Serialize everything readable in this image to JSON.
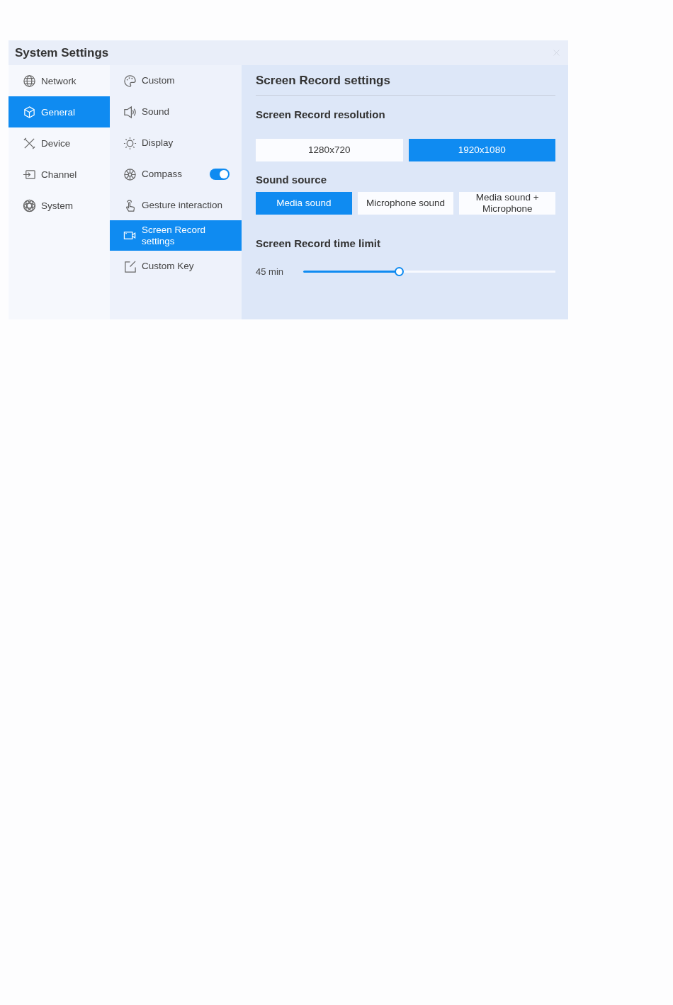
{
  "window": {
    "title": "System Settings"
  },
  "sidebar": {
    "items": [
      {
        "label": "Network",
        "selected": false
      },
      {
        "label": "General",
        "selected": true
      },
      {
        "label": "Device",
        "selected": false
      },
      {
        "label": "Channel",
        "selected": false
      },
      {
        "label": "System",
        "selected": false
      }
    ]
  },
  "submenu": {
    "items": [
      {
        "label": "Custom",
        "kind": "link",
        "selected": false
      },
      {
        "label": "Sound",
        "kind": "link",
        "selected": false
      },
      {
        "label": "Display",
        "kind": "link",
        "selected": false
      },
      {
        "label": "Compass",
        "kind": "toggle",
        "on": true,
        "selected": false
      },
      {
        "label": "Gesture interaction",
        "kind": "link",
        "selected": false
      },
      {
        "label": "Screen Record settings",
        "kind": "link",
        "selected": true
      },
      {
        "label": "Custom Key",
        "kind": "link",
        "selected": false
      }
    ]
  },
  "panel": {
    "title": "Screen Record settings",
    "sections": [
      {
        "heading": "Screen Record resolution",
        "kind": "options",
        "options": [
          {
            "label": "1280x720",
            "selected": false
          },
          {
            "label": "1920x1080",
            "selected": true
          }
        ]
      },
      {
        "heading": "Sound source",
        "kind": "options",
        "options": [
          {
            "label": "Media sound",
            "selected": true
          },
          {
            "label": "Microphone sound",
            "selected": false
          },
          {
            "label": "Media sound + Microphone",
            "selected": false
          }
        ]
      },
      {
        "heading": "Screen Record time limit",
        "kind": "slider",
        "reading": "45 min",
        "level": 0.38
      }
    ]
  }
}
